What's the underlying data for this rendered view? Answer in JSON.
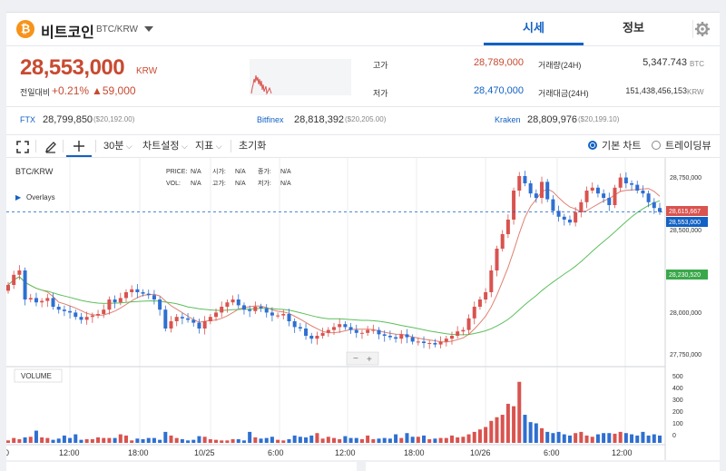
{
  "header": {
    "coin_logo": "₿",
    "coin_name": "비트코인",
    "coin_pair": "BTC/KRW",
    "tabs": [
      "시세",
      "정보"
    ],
    "icons": [
      "bitcoin-logo-icon",
      "chevron-down-icon",
      "gear-icon"
    ]
  },
  "ticker": {
    "price": "28,553,000",
    "currency": "KRW",
    "change_label": "전일대비",
    "change_rate": "+0.21%",
    "change_amount": "▲59,000",
    "high_label": "고가",
    "high_value": "28,789,000",
    "low_label": "저가",
    "low_value": "28,470,000",
    "volume_label": "거래량(24H)",
    "volume_value": "5,347.743",
    "volume_unit": "BTC",
    "amount_label": "거래대금(24H)",
    "amount_value": "151,438,456,153",
    "amount_unit": "KRW",
    "colors": {
      "up": "#c84a31",
      "down": "#1261c4"
    }
  },
  "exchanges": [
    {
      "name": "FTX",
      "price": "28,799,850",
      "usd": "($20,192.00)"
    },
    {
      "name": "Bitfinex",
      "price": "28,818,392",
      "usd": "($20,205.00)"
    },
    {
      "name": "Kraken",
      "price": "28,809,976",
      "usd": "($20,199.10)"
    }
  ],
  "toolbar": {
    "interval": "30분",
    "chart_settings": "차트설정",
    "indicators": "지표",
    "reset": "초기화",
    "basic_chart": "기본 차트",
    "trading_view": "트레이딩뷰",
    "icons": [
      "fullscreen-icon",
      "pencil-icon",
      "crosshair-icon",
      "chevron-down-icon"
    ]
  },
  "chart": {
    "pair": "BTC/KRW",
    "overlays": "Overlays",
    "info_rows": [
      [
        {
          "k": "PRICE:",
          "v": "N/A"
        },
        {
          "k": "시가:",
          "v": "N/A"
        },
        {
          "k": "종가:",
          "v": "N/A"
        }
      ],
      [
        {
          "k": "VOL:",
          "v": "N/A"
        },
        {
          "k": "고가:",
          "v": "N/A"
        },
        {
          "k": "저가:",
          "v": "N/A"
        }
      ]
    ],
    "volume_label": "VOLUME",
    "y_ticks": [
      "28,750,000",
      "28,500,000",
      "28,000,000",
      "27,750,000"
    ],
    "vol_ticks": [
      "500",
      "400",
      "300",
      "200",
      "100",
      "0"
    ],
    "x_ticks": [
      "0",
      "12:00",
      "18:00",
      "10/25",
      "6:00",
      "12:00",
      "18:00",
      "10/26",
      "6:00",
      "12:00"
    ],
    "tags": [
      {
        "text": "28,615,667",
        "color": "#d9534f"
      },
      {
        "text": "28,553,000",
        "color": "#1261c4"
      },
      {
        "text": "28,230,520",
        "color": "#3aa84a"
      }
    ]
  },
  "chart_data": {
    "type": "candlestick",
    "y_range": [
      27500000,
      28900000
    ],
    "vol_range": [
      0,
      550
    ],
    "closes": [
      28050000,
      28120000,
      28150000,
      27950000,
      27960000,
      27930000,
      27940000,
      27960000,
      27900000,
      27880000,
      27870000,
      27860000,
      27830000,
      27810000,
      27830000,
      27840000,
      27850000,
      27880000,
      27950000,
      27930000,
      27960000,
      28000000,
      28020000,
      28000000,
      27990000,
      27980000,
      27950000,
      27880000,
      27750000,
      27800000,
      27830000,
      27820000,
      27810000,
      27790000,
      27750000,
      27800000,
      27830000,
      27860000,
      27900000,
      27930000,
      27950000,
      27910000,
      27880000,
      27870000,
      27900000,
      27890000,
      27860000,
      27840000,
      27840000,
      27850000,
      27800000,
      27760000,
      27750000,
      27700000,
      27680000,
      27700000,
      27720000,
      27740000,
      27760000,
      27780000,
      27760000,
      27740000,
      27720000,
      27720000,
      27740000,
      27740000,
      27710000,
      27700000,
      27690000,
      27680000,
      27710000,
      27690000,
      27660000,
      27660000,
      27650000,
      27650000,
      27640000,
      27660000,
      27680000,
      27700000,
      27730000,
      27740000,
      27820000,
      27900000,
      27950000,
      28000000,
      28150000,
      28300000,
      28400000,
      28500000,
      28700000,
      28800000,
      28750000,
      28680000,
      28650000,
      28760000,
      28640000,
      28560000,
      28520000,
      28500000,
      28480000,
      28550000,
      28620000,
      28700000,
      28720000,
      28680000,
      28650000,
      28600000,
      28720000,
      28790000,
      28750000,
      28740000,
      28700000,
      28680000,
      28620000,
      28580000,
      28553000
    ],
    "volumes": [
      20,
      40,
      30,
      45,
      50,
      100,
      45,
      40,
      25,
      35,
      60,
      40,
      70,
      25,
      30,
      30,
      45,
      40,
      40,
      40,
      70,
      60,
      20,
      35,
      30,
      40,
      40,
      25,
      90,
      60,
      40,
      30,
      20,
      25,
      55,
      50,
      30,
      25,
      20,
      20,
      30,
      30,
      20,
      90,
      45,
      35,
      40,
      50,
      25,
      20,
      30,
      60,
      50,
      45,
      60,
      80,
      35,
      50,
      40,
      30,
      55,
      40,
      40,
      30,
      60,
      30,
      35,
      40,
      35,
      70,
      40,
      80,
      50,
      50,
      60,
      30,
      35,
      40,
      40,
      60,
      45,
      50,
      70,
      90,
      110,
      130,
      180,
      210,
      230,
      320,
      300,
      500,
      230,
      170,
      160,
      120,
      90,
      80,
      90,
      70,
      60,
      80,
      90,
      60,
      50,
      70,
      80,
      80,
      75,
      90,
      80,
      70,
      60,
      90,
      60,
      70,
      60
    ]
  }
}
